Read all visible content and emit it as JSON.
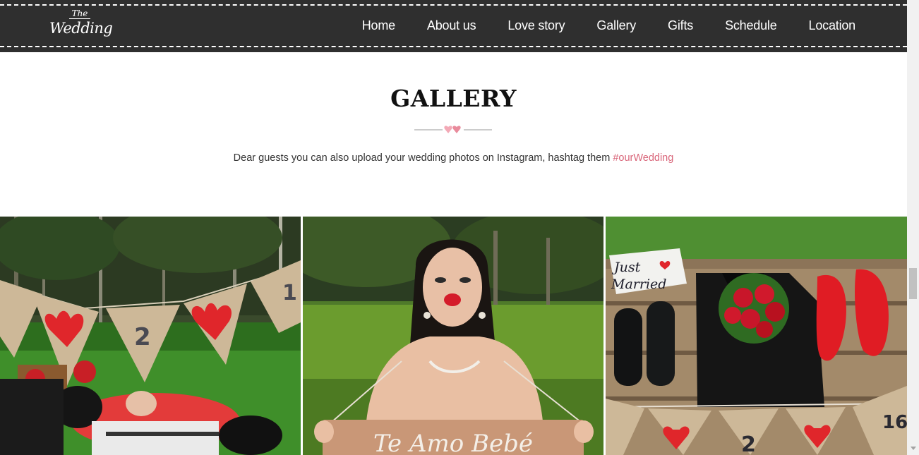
{
  "header": {
    "logo_top": "The",
    "logo_main": "Wedding",
    "nav": [
      {
        "label": "Home"
      },
      {
        "label": "About us"
      },
      {
        "label": "Love story"
      },
      {
        "label": "Gallery"
      },
      {
        "label": "Gifts"
      },
      {
        "label": "Schedule"
      },
      {
        "label": "Location"
      }
    ]
  },
  "gallery": {
    "title": "GALLERY",
    "subtitle": "Dear guests you can also upload your wedding photos on Instagram, hashtag them ",
    "hashtag": "#ourWedding",
    "accent_color": "#d9667a"
  },
  "photos": [
    {
      "bunting_number": "2",
      "bunting_number_partial": "1"
    },
    {
      "sign_text": "Te Amo Bebé"
    },
    {
      "sign_text_line1": "Just",
      "sign_text_line2": "Married",
      "bunting_number": "2",
      "bunting_number_partial": "16"
    }
  ]
}
